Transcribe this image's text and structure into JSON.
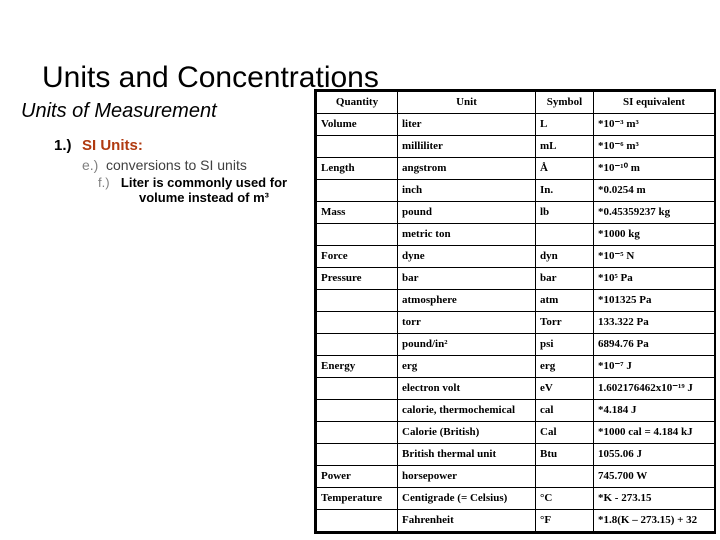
{
  "slide": {
    "title": "Units and Concentrations",
    "subhead": "Units of Measurement",
    "bullets": {
      "level1": {
        "marker": "1.)",
        "text": "SI Units:",
        "color": "#B03A10"
      },
      "level2": {
        "marker": "e.)",
        "text": "conversions to SI units",
        "color": "#404040"
      },
      "level3": {
        "marker": "f.)",
        "text": "Liter is commonly used for volume instead of m³",
        "color": "#000000"
      }
    }
  },
  "table": {
    "headers": [
      "Quantity",
      "Unit",
      "Symbol",
      "SI equivalent"
    ],
    "rows": [
      {
        "quantity": "Volume",
        "unit": "liter",
        "symbol": "L",
        "si": "*10⁻³ m³"
      },
      {
        "quantity": "",
        "unit": "milliliter",
        "symbol": "mL",
        "si": "*10⁻⁶ m³"
      },
      {
        "quantity": "Length",
        "unit": "angstrom",
        "symbol": "Å",
        "si": "*10⁻¹⁰ m"
      },
      {
        "quantity": "",
        "unit": "inch",
        "symbol": "In.",
        "si": "*0.0254 m"
      },
      {
        "quantity": "Mass",
        "unit": "pound",
        "symbol": "lb",
        "si": "*0.45359237 kg"
      },
      {
        "quantity": "",
        "unit": "metric ton",
        "symbol": "",
        "si": "*1000 kg"
      },
      {
        "quantity": "Force",
        "unit": "dyne",
        "symbol": "dyn",
        "si": "*10⁻⁵ N"
      },
      {
        "quantity": "Pressure",
        "unit": "bar",
        "symbol": "bar",
        "si": "*10⁵ Pa"
      },
      {
        "quantity": "",
        "unit": "atmosphere",
        "symbol": "atm",
        "si": "*101325 Pa"
      },
      {
        "quantity": "",
        "unit": "torr",
        "symbol": "Torr",
        "si": "133.322 Pa"
      },
      {
        "quantity": "",
        "unit": "pound/in²",
        "symbol": "psi",
        "si": "6894.76 Pa"
      },
      {
        "quantity": "Energy",
        "unit": "erg",
        "symbol": "erg",
        "si": "*10⁻⁷ J"
      },
      {
        "quantity": "",
        "unit": "electron volt",
        "symbol": "eV",
        "si": "1.602176462x10⁻¹⁹ J"
      },
      {
        "quantity": "",
        "unit": "calorie, thermochemical",
        "symbol": "cal",
        "si": "*4.184 J"
      },
      {
        "quantity": "",
        "unit": "Calorie (British)",
        "symbol": "Cal",
        "si": "*1000 cal = 4.184 kJ"
      },
      {
        "quantity": "",
        "unit": "British thermal unit",
        "symbol": "Btu",
        "si": "1055.06 J"
      },
      {
        "quantity": "Power",
        "unit": "horsepower",
        "symbol": "",
        "si": "745.700 W"
      },
      {
        "quantity": "Temperature",
        "unit": "Centigrade (= Celsius)",
        "symbol": "°C",
        "si": "*K - 273.15"
      },
      {
        "quantity": "",
        "unit": "Fahrenheit",
        "symbol": "°F",
        "si": "*1.8(K – 273.15) + 32"
      }
    ]
  }
}
